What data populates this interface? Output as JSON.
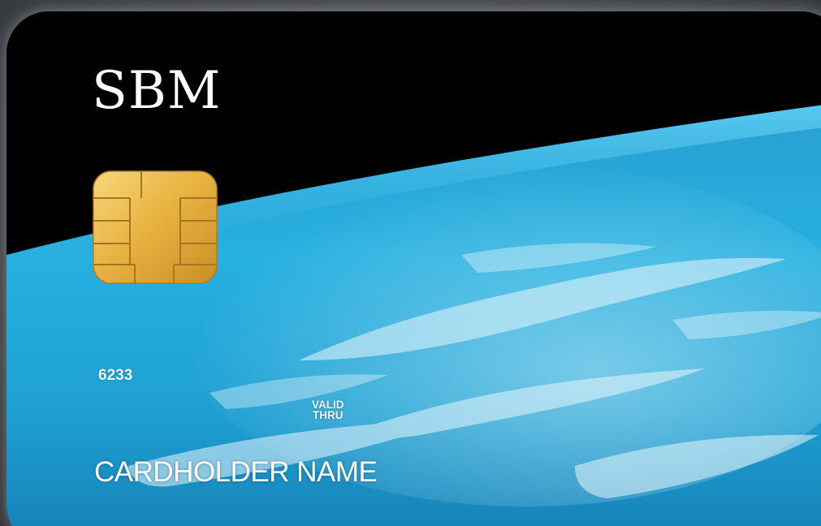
{
  "card": {
    "brand": "SBM",
    "number_partial": "6233",
    "valid_line1": "VALID",
    "valid_line2": "THRU",
    "cardholder": "CARDHOLDER NAME"
  },
  "colors": {
    "space": "#000000",
    "ocean": "#1fa6d8",
    "chip_gold": "#e6b84a"
  },
  "icons": {
    "chip": "emv-chip-icon"
  }
}
